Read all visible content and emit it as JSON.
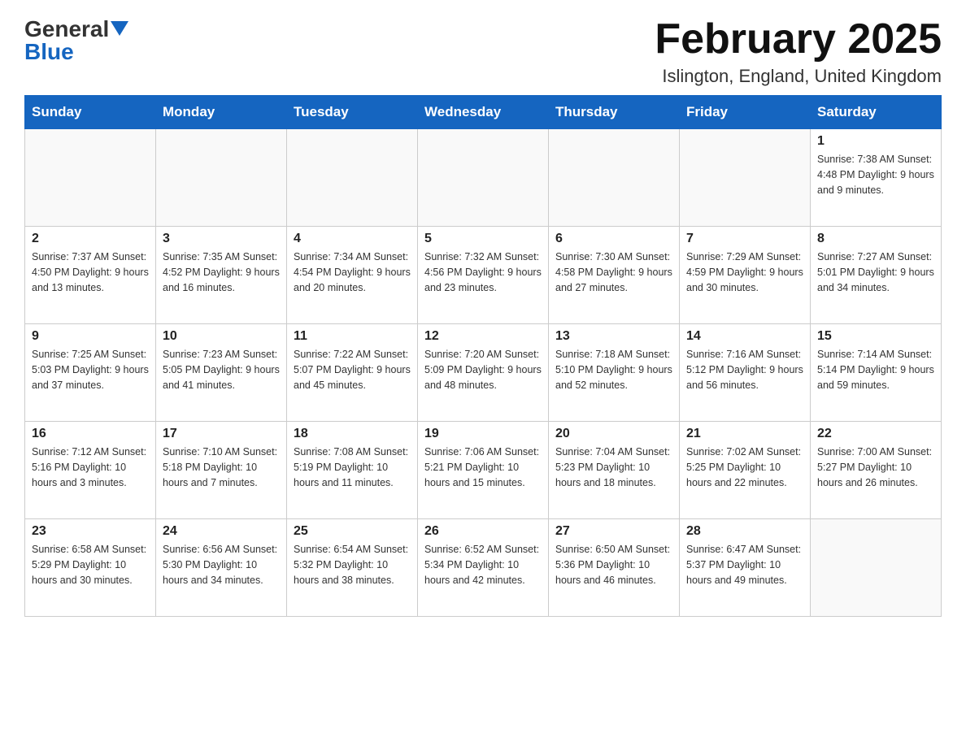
{
  "header": {
    "logo_general": "General",
    "logo_blue": "Blue",
    "month_title": "February 2025",
    "location": "Islington, England, United Kingdom"
  },
  "days_of_week": [
    "Sunday",
    "Monday",
    "Tuesday",
    "Wednesday",
    "Thursday",
    "Friday",
    "Saturday"
  ],
  "weeks": [
    [
      {
        "num": "",
        "info": ""
      },
      {
        "num": "",
        "info": ""
      },
      {
        "num": "",
        "info": ""
      },
      {
        "num": "",
        "info": ""
      },
      {
        "num": "",
        "info": ""
      },
      {
        "num": "",
        "info": ""
      },
      {
        "num": "1",
        "info": "Sunrise: 7:38 AM\nSunset: 4:48 PM\nDaylight: 9 hours and 9 minutes."
      }
    ],
    [
      {
        "num": "2",
        "info": "Sunrise: 7:37 AM\nSunset: 4:50 PM\nDaylight: 9 hours and 13 minutes."
      },
      {
        "num": "3",
        "info": "Sunrise: 7:35 AM\nSunset: 4:52 PM\nDaylight: 9 hours and 16 minutes."
      },
      {
        "num": "4",
        "info": "Sunrise: 7:34 AM\nSunset: 4:54 PM\nDaylight: 9 hours and 20 minutes."
      },
      {
        "num": "5",
        "info": "Sunrise: 7:32 AM\nSunset: 4:56 PM\nDaylight: 9 hours and 23 minutes."
      },
      {
        "num": "6",
        "info": "Sunrise: 7:30 AM\nSunset: 4:58 PM\nDaylight: 9 hours and 27 minutes."
      },
      {
        "num": "7",
        "info": "Sunrise: 7:29 AM\nSunset: 4:59 PM\nDaylight: 9 hours and 30 minutes."
      },
      {
        "num": "8",
        "info": "Sunrise: 7:27 AM\nSunset: 5:01 PM\nDaylight: 9 hours and 34 minutes."
      }
    ],
    [
      {
        "num": "9",
        "info": "Sunrise: 7:25 AM\nSunset: 5:03 PM\nDaylight: 9 hours and 37 minutes."
      },
      {
        "num": "10",
        "info": "Sunrise: 7:23 AM\nSunset: 5:05 PM\nDaylight: 9 hours and 41 minutes."
      },
      {
        "num": "11",
        "info": "Sunrise: 7:22 AM\nSunset: 5:07 PM\nDaylight: 9 hours and 45 minutes."
      },
      {
        "num": "12",
        "info": "Sunrise: 7:20 AM\nSunset: 5:09 PM\nDaylight: 9 hours and 48 minutes."
      },
      {
        "num": "13",
        "info": "Sunrise: 7:18 AM\nSunset: 5:10 PM\nDaylight: 9 hours and 52 minutes."
      },
      {
        "num": "14",
        "info": "Sunrise: 7:16 AM\nSunset: 5:12 PM\nDaylight: 9 hours and 56 minutes."
      },
      {
        "num": "15",
        "info": "Sunrise: 7:14 AM\nSunset: 5:14 PM\nDaylight: 9 hours and 59 minutes."
      }
    ],
    [
      {
        "num": "16",
        "info": "Sunrise: 7:12 AM\nSunset: 5:16 PM\nDaylight: 10 hours and 3 minutes."
      },
      {
        "num": "17",
        "info": "Sunrise: 7:10 AM\nSunset: 5:18 PM\nDaylight: 10 hours and 7 minutes."
      },
      {
        "num": "18",
        "info": "Sunrise: 7:08 AM\nSunset: 5:19 PM\nDaylight: 10 hours and 11 minutes."
      },
      {
        "num": "19",
        "info": "Sunrise: 7:06 AM\nSunset: 5:21 PM\nDaylight: 10 hours and 15 minutes."
      },
      {
        "num": "20",
        "info": "Sunrise: 7:04 AM\nSunset: 5:23 PM\nDaylight: 10 hours and 18 minutes."
      },
      {
        "num": "21",
        "info": "Sunrise: 7:02 AM\nSunset: 5:25 PM\nDaylight: 10 hours and 22 minutes."
      },
      {
        "num": "22",
        "info": "Sunrise: 7:00 AM\nSunset: 5:27 PM\nDaylight: 10 hours and 26 minutes."
      }
    ],
    [
      {
        "num": "23",
        "info": "Sunrise: 6:58 AM\nSunset: 5:29 PM\nDaylight: 10 hours and 30 minutes."
      },
      {
        "num": "24",
        "info": "Sunrise: 6:56 AM\nSunset: 5:30 PM\nDaylight: 10 hours and 34 minutes."
      },
      {
        "num": "25",
        "info": "Sunrise: 6:54 AM\nSunset: 5:32 PM\nDaylight: 10 hours and 38 minutes."
      },
      {
        "num": "26",
        "info": "Sunrise: 6:52 AM\nSunset: 5:34 PM\nDaylight: 10 hours and 42 minutes."
      },
      {
        "num": "27",
        "info": "Sunrise: 6:50 AM\nSunset: 5:36 PM\nDaylight: 10 hours and 46 minutes."
      },
      {
        "num": "28",
        "info": "Sunrise: 6:47 AM\nSunset: 5:37 PM\nDaylight: 10 hours and 49 minutes."
      },
      {
        "num": "",
        "info": ""
      }
    ]
  ]
}
